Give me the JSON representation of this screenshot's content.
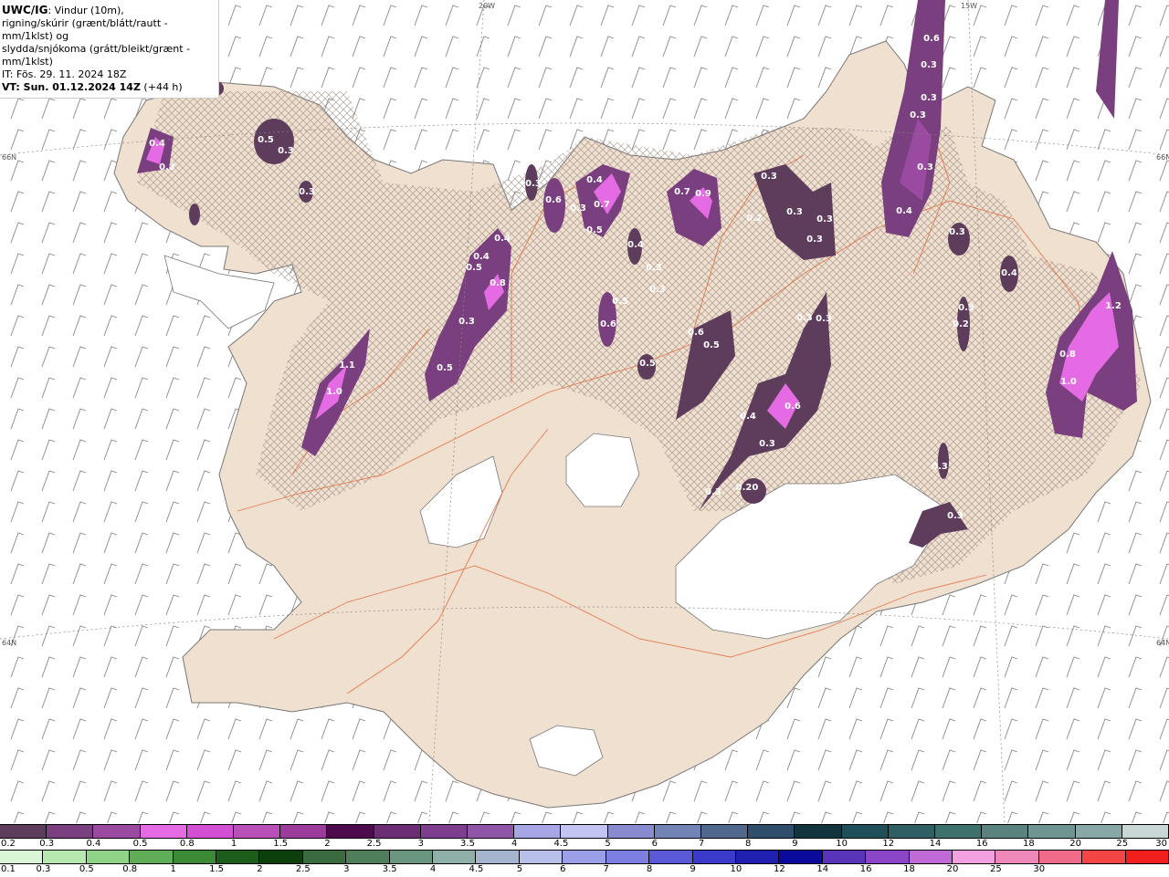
{
  "info": {
    "title": "UWC/IG",
    "line1_rest": ": Vindur (10m),",
    "line2": "rigning/skúrir (grænt/blátt/rautt - mm/1klst) og",
    "line3": "slydda/snjókoma (grátt/bleikt/grænt - mm/1klst)",
    "it": "IT: Fös. 29. 11. 2024 18Z",
    "vt_bold": "VT: Sun. 01.12.2024 14Z",
    "vt_rest": " (+44 h)"
  },
  "axes": {
    "lon1": "20W",
    "lon2": "15W",
    "lat_top_left": "66N",
    "lat_bot_left": "64N",
    "lat_top_right": "66N",
    "lat_bot_right": "64N"
  },
  "legend_snow": {
    "labels": [
      "0.2",
      "0.3",
      "0.4",
      "0.5",
      "0.8",
      "1",
      "1.5",
      "2",
      "2.5",
      "3",
      "3.5",
      "4",
      "4.5",
      "5",
      "6",
      "7",
      "8",
      "9",
      "10",
      "12",
      "14",
      "16",
      "18",
      "20",
      "25",
      "30"
    ],
    "colors": [
      "#5e3c5c",
      "#7a3f7e",
      "#9a4aa0",
      "#e56be5",
      "#d34fd3",
      "#b94fb9",
      "#9b3c9b",
      "#4d0a4d",
      "#6b2d73",
      "#7e3d8e",
      "#8f55a8",
      "#a7a7e6",
      "#c4c4f2",
      "#8a8ad0",
      "#7085b6",
      "#51688d",
      "#2e4e6b",
      "#12343d",
      "#1f4f59",
      "#2f5f62",
      "#3e706c",
      "#5a8380",
      "#6f9593",
      "#88a8a6",
      "#c9d8d6"
    ]
  },
  "legend_rain": {
    "labels": [
      "0.1",
      "0.3",
      "0.5",
      "0.8",
      "1",
      "1.5",
      "2",
      "2.5",
      "3",
      "3.5",
      "4",
      "4.5",
      "5",
      "6",
      "7",
      "8",
      "9",
      "10",
      "12",
      "14",
      "16",
      "18",
      "20",
      "25",
      "30"
    ],
    "colors": [
      "#d9f7d4",
      "#b7e8b0",
      "#8fd386",
      "#5fae57",
      "#3b8a35",
      "#1c5e19",
      "#0b3f0b",
      "#3a6b3f",
      "#4e7f5a",
      "#6a9680",
      "#8eb0a9",
      "#a6b5cf",
      "#b8bfe8",
      "#9b9fe8",
      "#7d7fe0",
      "#5a5ad8",
      "#3a3acb",
      "#1f1fb0",
      "#0a0a9c",
      "#5933b8",
      "#8b45c7",
      "#c06ad8",
      "#f2a0e0",
      "#ee88bb",
      "#f06a8a",
      "#f44545",
      "#f21f1f"
    ]
  },
  "precip_labels": [
    "0.4",
    "0.3",
    "0.5",
    "0.3",
    "0.3",
    "0.3",
    "0.6",
    "0.3",
    "0.4",
    "0.7",
    "0.5",
    "0.7",
    "0.9",
    "0.3",
    "0.3",
    "0.2",
    "0.3",
    "0.3",
    "0.3",
    "0.3",
    "0.3",
    "0.6",
    "0.4",
    "0.3",
    "0.3",
    "0.4",
    "0.4",
    "0.4",
    "0.8",
    "0.3",
    "0.6",
    "0.5",
    "0.5",
    "0.3",
    "0.3",
    "0.6",
    "0.5",
    "1.1",
    "1.0",
    "0.5",
    "0.5",
    "0.4",
    "0.6",
    "0.4",
    "0.3",
    "0.20",
    "0.3",
    "0.3",
    "0.3",
    "0.2",
    "0.3",
    "1.2",
    "0.8",
    "1.0",
    "0.3",
    "0.3"
  ]
}
